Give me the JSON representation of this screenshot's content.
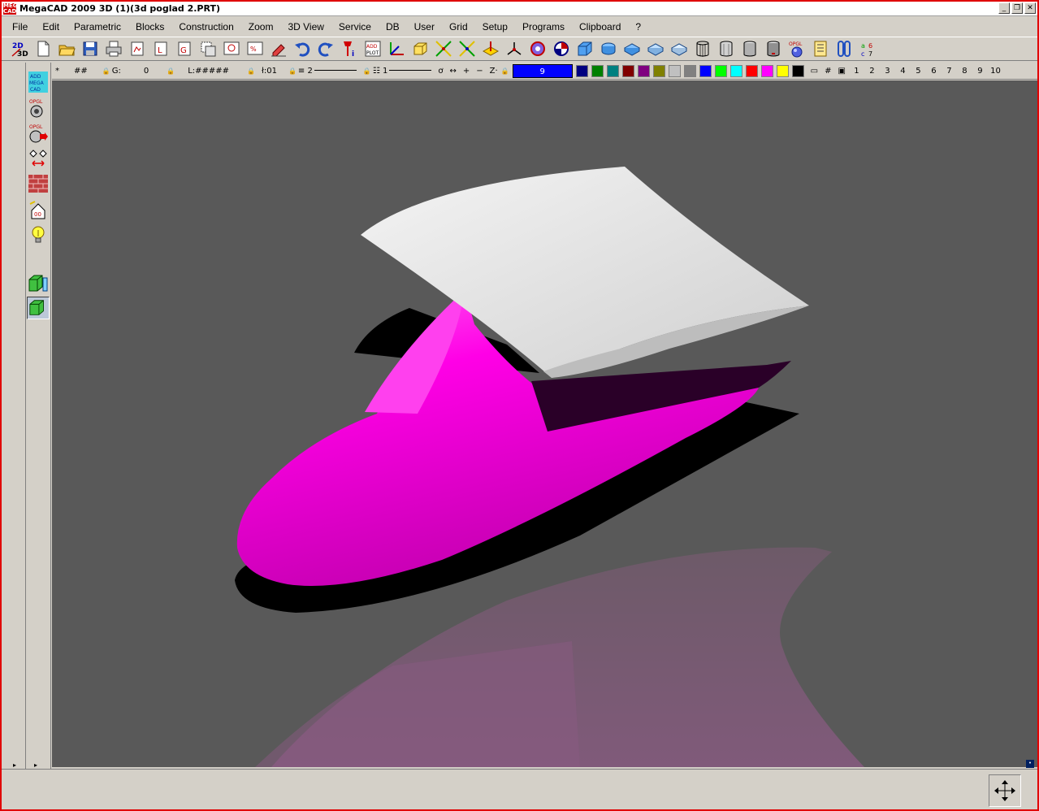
{
  "window": {
    "title": "MegaCAD 2009 3D (1)(3d poglad 2.PRT)",
    "app_icon_text": "MEGA CAD"
  },
  "menu": [
    "File",
    "Edit",
    "Parametric",
    "Blocks",
    "Construction",
    "Zoom",
    "3D View",
    "Service",
    "DB",
    "User",
    "Grid",
    "Setup",
    "Programs",
    "Clipboard",
    "?"
  ],
  "toolbar": {
    "mode_label": "2D 3D",
    "opgl_label": "OPGL",
    "icons": [
      "2d-3d-toggle-icon",
      "new-file-icon",
      "open-folder-icon",
      "save-icon",
      "print-icon",
      "plot-icon",
      "blocks-icon",
      "layer-icon",
      "group-icon",
      "zoom-window-icon",
      "zoom-reset-icon",
      "eraser-icon",
      "undo-icon",
      "redo-icon",
      "info-pin-icon",
      "plot-add-icon",
      "axis-icon",
      "box-icon",
      "intersect-icon",
      "trim-icon",
      "plane-icon",
      "snap-icon",
      "sphere-gizmo-icon",
      "target-icon",
      "cube-icon",
      "cylinder-shade-icon",
      "slab-icon",
      "slab-2-icon",
      "slab-3-icon",
      "wire-cylinder-icon",
      "hidden-cylinder-icon",
      "gray-cylinder-icon",
      "drum-icon",
      "opgl-sphere-icon",
      "document-list-icon",
      "clip-icon",
      "color-code-icon"
    ]
  },
  "statusbar": {
    "star": "*",
    "grid": "##",
    "group_label": "G:",
    "group_value": "0",
    "layer_label": "L:#####",
    "font_label": "ł:01",
    "line_weight": "2",
    "line_type": "1",
    "color_value": "9",
    "colors": [
      "#000080",
      "#008000",
      "#008080",
      "#800000",
      "#800080",
      "#808000",
      "#c0c0c0",
      "#808080",
      "#0000ff",
      "#00ff00",
      "#00ffff",
      "#ff0000",
      "#ff00ff",
      "#ffff00",
      "#000000"
    ],
    "views": [
      "1",
      "2",
      "3",
      "4",
      "5",
      "6",
      "7",
      "8",
      "9",
      "10"
    ]
  },
  "left_tools": {
    "add_label": "ADD MEGA CAD",
    "opgl_label": "OPGL",
    "items": [
      "add-megacad-icon",
      "opgl-render-icon",
      "opgl-export-icon",
      "transform-icon",
      "texture-brick-icon",
      "home-00-icon",
      "light-bulb-icon",
      "green-solid-icon",
      "green-solid-active-icon"
    ]
  },
  "accent": {
    "window_border": "#e00000",
    "viewport_bg": "#595959",
    "model_color": "#ff00e6"
  }
}
